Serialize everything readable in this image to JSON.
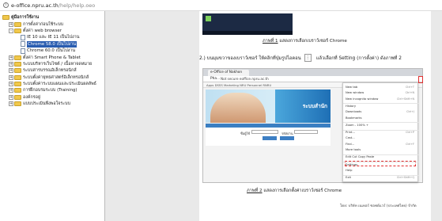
{
  "address": {
    "host": "e-office.npru.ac.th",
    "path": "/help/help.oeo"
  },
  "tree": {
    "root": "คู่มือการใช้งาน",
    "items": [
      {
        "label": "การตั้งค่าก่อนใช้ระบบ",
        "level": 1,
        "kind": "folder",
        "toggle": "+"
      },
      {
        "label": "ตั้งค่า web browser",
        "level": 1,
        "kind": "folder",
        "toggle": "-"
      },
      {
        "label": "IE 10 และ IE 11 เป็นไปงาน",
        "level": 2,
        "kind": "doc",
        "toggle": ""
      },
      {
        "label": "Chrome 58.0 เป็นไปงาน",
        "level": 2,
        "kind": "doc",
        "toggle": "",
        "selected": true
      },
      {
        "label": "Chrome 60.0 เป็นไปงาน",
        "level": 2,
        "kind": "doc",
        "toggle": ""
      },
      {
        "label": "ตั้งค่า Smart Phone & Tablet",
        "level": 1,
        "kind": "folder",
        "toggle": "+"
      },
      {
        "label": "ระบบบริหารเว็บไซต์ / เนื้อหาจดหมาย",
        "level": 1,
        "kind": "folder",
        "toggle": "+"
      },
      {
        "label": "ระบบสารบรรณอิเล็กทรอนิกส์",
        "level": 1,
        "kind": "folder",
        "toggle": "+"
      },
      {
        "label": "ระบบตั้งค่ายุทธศาสตร์อิเล็กทรอนิกส์",
        "level": 1,
        "kind": "folder",
        "toggle": "+"
      },
      {
        "label": "ระบบตั้งค่าระบบแผนและประเมินผลลัพธ์",
        "level": 1,
        "kind": "folder",
        "toggle": "+"
      },
      {
        "label": "การฝึกอบรมระบบ (Training)",
        "level": 1,
        "kind": "folder",
        "toggle": "+"
      },
      {
        "label": "องค์กรอยู่",
        "level": 1,
        "kind": "folder",
        "toggle": "+"
      },
      {
        "label": "แบบประเมินพึงพอใจระบบ",
        "level": 1,
        "kind": "folder",
        "toggle": "+"
      }
    ]
  },
  "document": {
    "caption1_prefix": "ภาพที่ 1",
    "caption1_text": " แสดงการเลือกเบราว์เซอร์ Chrome",
    "instruction_pre": "2.)  บนมุมขวาของเบราว์เซอร์ ให้คลิกที่ปุ่มรูปไอคอน",
    "menu_icon": "⋮",
    "instruction_post": "แล้วเลือกที่ Setting (การตั้งค่า) ดังภาพที่ 2",
    "caption2_prefix": "ภาพที่ 2",
    "caption2_text": " แสดงการเลือกตั้งค่าเบราว์เซอร์ Chrome",
    "footer": "โดย: บริษัท เนเทอร์ ซอฟต์แวร์ (ประเทศไทย) จำกัด"
  },
  "browser_shot": {
    "tab": "e-Office of Nakhon Pha...",
    "url": "Not secure  eoffice.npru.ac.th",
    "bookmarks": "Apps   DSSS   Marketing   NRU   Personnel   RNRU",
    "banner_text": "ระบบสำนัก",
    "login_label_user": "ชื่อผู้ใช้",
    "login_label_pass": "รหัสผ่าน",
    "menu": [
      {
        "label": "New tab",
        "key": "Ctrl+T"
      },
      {
        "label": "New window",
        "key": "Ctrl+N"
      },
      {
        "label": "New incognito window",
        "key": "Ctrl+Shift+N"
      },
      {
        "label": "History",
        "key": ""
      },
      {
        "label": "Downloads",
        "key": "Ctrl+J"
      },
      {
        "label": "Bookmarks",
        "key": ""
      },
      {
        "label": "Zoom    -   100%   +",
        "key": ""
      },
      {
        "label": "Print...",
        "key": "Ctrl+P"
      },
      {
        "label": "Cast...",
        "key": ""
      },
      {
        "label": "Find...",
        "key": "Ctrl+F"
      },
      {
        "label": "More tools",
        "key": ""
      },
      {
        "label": "Edit      Cut      Copy      Paste",
        "key": ""
      },
      {
        "label": "Settings",
        "key": ""
      },
      {
        "label": "Help",
        "key": ""
      },
      {
        "label": "Exit",
        "key": "Ctrl+Shift+Q"
      }
    ]
  },
  "colors": {
    "selection": "#2a5db0",
    "highlight": "#e03030",
    "folder": "#f1c84b"
  }
}
